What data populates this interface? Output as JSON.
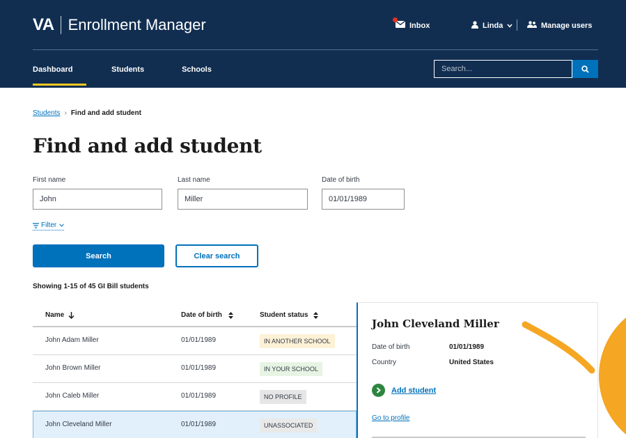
{
  "header": {
    "brand_short": "VA",
    "brand_title": "Enrollment Manager",
    "inbox_label": "Inbox",
    "user_label": "Linda",
    "manage_users_label": "Manage users",
    "nav": {
      "dashboard": "Dashboard",
      "students": "Students",
      "schools": "Schools"
    },
    "search_placeholder": "Search..."
  },
  "breadcrumb": {
    "parent": "Students",
    "current": "Find and add student"
  },
  "page_title": "Find and add student",
  "form": {
    "first_name": {
      "label": "First name",
      "value": "John"
    },
    "last_name": {
      "label": "Last name",
      "value": "Miller"
    },
    "date_of_birth": {
      "label": "Date of birth",
      "value": "01/01/1989"
    },
    "filter_label": "Filter",
    "search_button": "Search",
    "clear_button": "Clear search"
  },
  "results": {
    "summary": "Showing 1-15 of 45 GI Bill students",
    "columns": {
      "name": "Name",
      "dob": "Date of birth",
      "status": "Student status"
    },
    "rows": [
      {
        "name": "John Adam Miller",
        "dob": "01/01/1989",
        "status": "IN ANOTHER SCHOOL"
      },
      {
        "name": "John Brown Miller",
        "dob": "01/01/1989",
        "status": "IN YOUR SCHOOL"
      },
      {
        "name": "John Caleb Miller",
        "dob": "01/01/1989",
        "status": "NO PROFILE"
      },
      {
        "name": "John Cleveland Miller",
        "dob": "01/01/1989",
        "status": "UNASSOCIATED"
      }
    ]
  },
  "panel": {
    "name": "John Cleveland Miller",
    "dob_label": "Date of birth",
    "dob_value": "01/01/1989",
    "country_label": "Country",
    "country_value": "United States",
    "add_student": "Add student",
    "go_to_profile": "Go to profile"
  },
  "colors": {
    "header_bg": "#112e51",
    "primary": "#0071bb",
    "nav_active": "#fac922",
    "notification": "#e5311c",
    "success": "#2e8540",
    "badge_another_school": "#fdf1d6",
    "badge_your_school": "#e7f4e4",
    "badge_no_profile": "#e6e6e6",
    "badge_unassociated": "#e9e9e9",
    "selected_row": "#e1f0fa",
    "decoration": "#f5a623"
  }
}
